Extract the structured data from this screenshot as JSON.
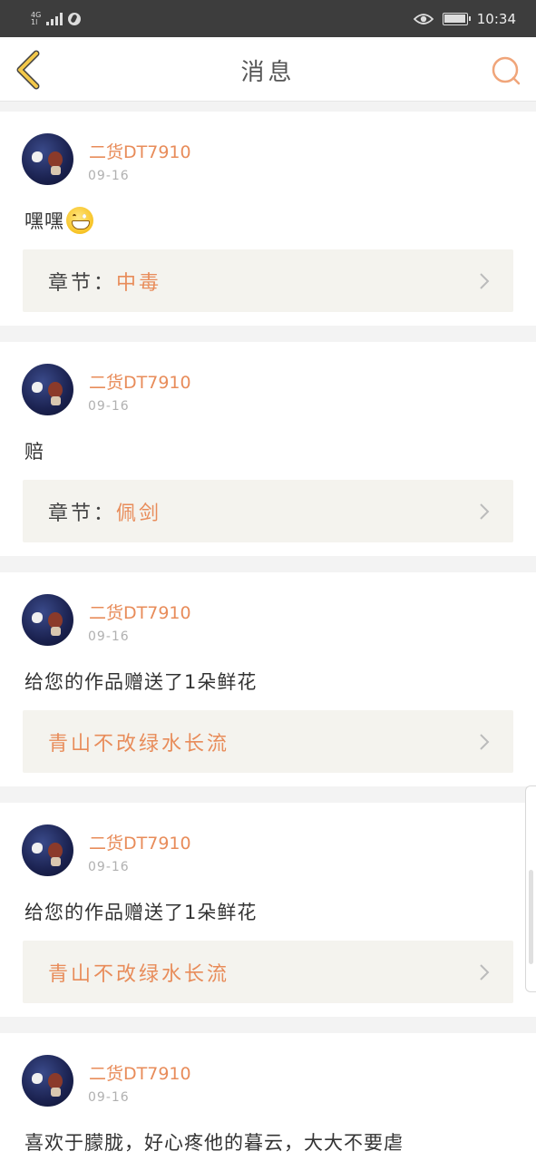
{
  "status_bar": {
    "network": "4G",
    "network_sub": "1l",
    "time": "10:34"
  },
  "nav": {
    "title": "消息",
    "back_icon": "chevron-left-icon",
    "search_icon": "search-icon"
  },
  "colors": {
    "accent": "#e88c5a",
    "back_icon": "#f3c84a",
    "link_bg": "#f4f3ee"
  },
  "messages": [
    {
      "username": "二货DT7910",
      "date": "09-16",
      "content": "嘿嘿",
      "emoji": "grinning-face",
      "link_prefix": "章节：",
      "link_value": "中毒"
    },
    {
      "username": "二货DT7910",
      "date": "09-16",
      "content": "赔",
      "link_prefix": "章节：",
      "link_value": "佩剑"
    },
    {
      "username": "二货DT7910",
      "date": "09-16",
      "content": "给您的作品赠送了1朵鲜花",
      "link_prefix": "",
      "link_value": "青山不改绿水长流"
    },
    {
      "username": "二货DT7910",
      "date": "09-16",
      "content": "给您的作品赠送了1朵鲜花",
      "link_prefix": "",
      "link_value": "青山不改绿水长流"
    },
    {
      "username": "二货DT7910",
      "date": "09-16",
      "content": "喜欢于朦胧，好心疼他的暮云，大大不要虐"
    }
  ]
}
